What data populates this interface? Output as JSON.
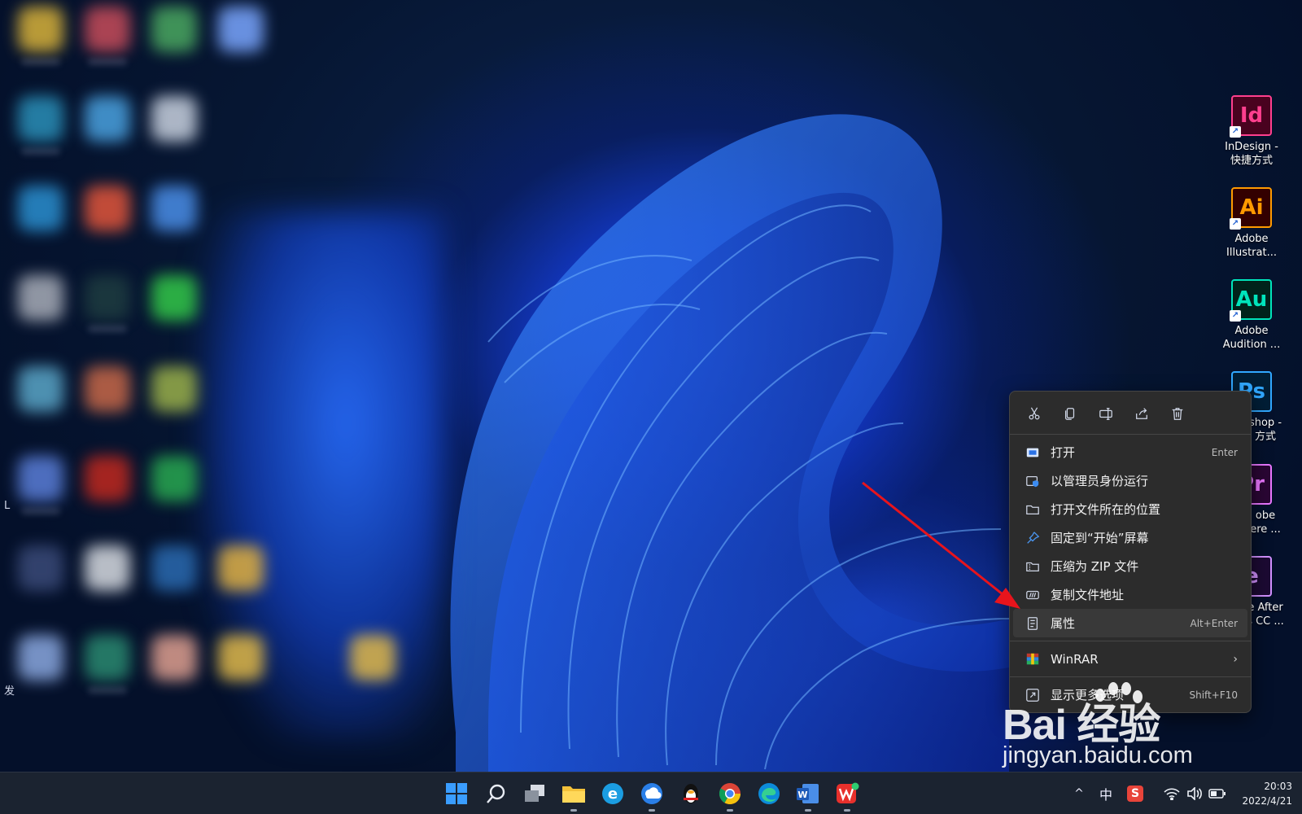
{
  "desktop": {
    "edge_fragments": [
      "L",
      "发"
    ],
    "shortcuts": [
      {
        "abbr": "Id",
        "label_line1": "InDesign -",
        "label_line2": "快捷方式",
        "color": "#ff3f8e",
        "bg": "#49021f"
      },
      {
        "abbr": "Ai",
        "label_line1": "Adobe",
        "label_line2": "Illustrat...",
        "color": "#ff9a00",
        "bg": "#330000"
      },
      {
        "abbr": "Au",
        "label_line1": "Adobe",
        "label_line2": "Audition ...",
        "color": "#00e4bb",
        "bg": "#00231b"
      },
      {
        "abbr": "Ps",
        "label_line1": "shop -",
        "label_line2": "方式",
        "color": "#31a8ff",
        "bg": "#001e36"
      },
      {
        "abbr": "Pr",
        "label_line1": "obe",
        "label_line2": "ere ...",
        "color": "#ea77ff",
        "bg": "#2a0634"
      },
      {
        "abbr": "e",
        "label_line1": "e After",
        "label_line2": "s CC ...",
        "color": "#d291ff",
        "bg": "#1c0a33"
      }
    ]
  },
  "context_menu": {
    "toolbar": [
      "cut",
      "copy",
      "rename",
      "share",
      "delete"
    ],
    "items": [
      {
        "label": "打开",
        "shortcut": "Enter"
      },
      {
        "label": "以管理员身份运行",
        "shortcut": ""
      },
      {
        "label": "打开文件所在的位置",
        "shortcut": ""
      },
      {
        "label": "固定到“开始”屏幕",
        "shortcut": ""
      },
      {
        "label": "压缩为 ZIP 文件",
        "shortcut": ""
      },
      {
        "label": "复制文件地址",
        "shortcut": ""
      },
      {
        "label": "属性",
        "shortcut": "Alt+Enter"
      }
    ],
    "winrar": {
      "label": "WinRAR",
      "chevron": "›"
    },
    "more_options": {
      "label": "显示更多选项",
      "shortcut": "Shift+F10"
    }
  },
  "watermark": {
    "brand": "Bai 经验",
    "url": "jingyan.baidu.com"
  },
  "taskbar": {
    "tray": {
      "chevron": "^",
      "ime": "中",
      "sogou": "S"
    },
    "clock": {
      "time": "20:03",
      "date": "2022/4/21"
    }
  },
  "colors": {
    "annotation_arrow": "#e8141c",
    "menu_bg": "#2c2c2c",
    "taskbar_bg": "#1b2330"
  }
}
